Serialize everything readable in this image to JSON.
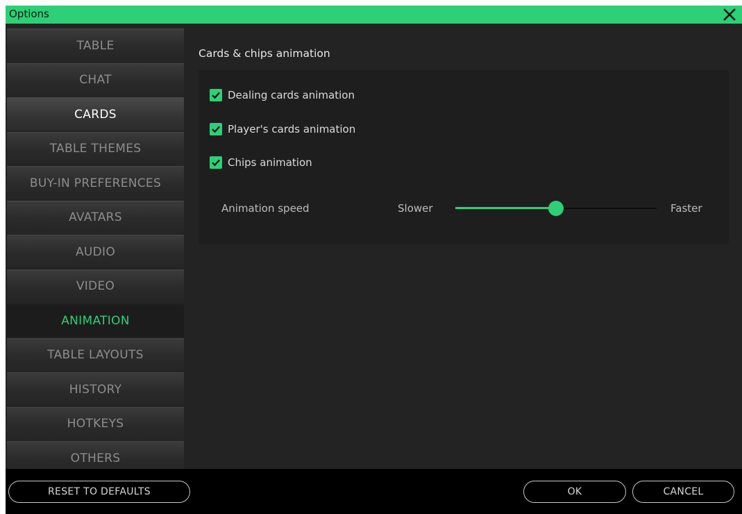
{
  "window": {
    "title": "Options"
  },
  "sidebar": {
    "items": [
      {
        "label": "TABLE"
      },
      {
        "label": "CHAT"
      },
      {
        "label": "CARDS"
      },
      {
        "label": "TABLE THEMES"
      },
      {
        "label": "BUY-IN PREFERENCES"
      },
      {
        "label": "AVATARS"
      },
      {
        "label": "AUDIO"
      },
      {
        "label": "VIDEO"
      },
      {
        "label": "ANIMATION"
      },
      {
        "label": "TABLE LAYOUTS"
      },
      {
        "label": "HISTORY"
      },
      {
        "label": "HOTKEYS"
      },
      {
        "label": "OTHERS"
      }
    ],
    "active": "ANIMATION"
  },
  "content": {
    "section_title": "Cards & chips animation",
    "checkboxes": [
      {
        "label": "Dealing cards animation",
        "checked": true
      },
      {
        "label": "Player's cards animation",
        "checked": true
      },
      {
        "label": "Chips animation",
        "checked": true
      }
    ],
    "speed": {
      "label": "Animation speed",
      "min_label": "Slower",
      "max_label": "Faster",
      "value": 0.5
    }
  },
  "footer": {
    "reset_label": "RESET TO DEFAULTS",
    "ok_label": "OK",
    "cancel_label": "CANCEL"
  },
  "colors": {
    "accent": "#2ed077",
    "background": "#232323",
    "footer": "#000000"
  },
  "icons": {
    "close": "close-icon",
    "check": "checkmark-icon"
  }
}
